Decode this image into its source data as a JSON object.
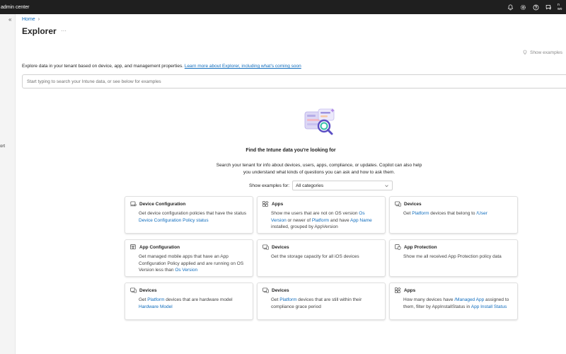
{
  "topbar": {
    "app_title": "admin center",
    "icons": [
      "bell-icon",
      "gear-icon",
      "help-icon",
      "feedback-icon"
    ],
    "account_line1": "n",
    "account_line2": "wo"
  },
  "leftnav": {
    "collapse_glyph": "«",
    "fragment_text": "ort"
  },
  "breadcrumb": {
    "home": "Home"
  },
  "page": {
    "title": "Explorer",
    "more": "···",
    "show_examples": "Show examples",
    "description": "Explore data in your tenant based on device, app, and management properties.",
    "description_link": "Learn more about Explorer, including what's coming soon"
  },
  "search": {
    "placeholder": "Start typing to search your Intune data, or see below for examples",
    "value": ""
  },
  "empty_state": {
    "title": "Find the Intune data you're looking for",
    "description": "Search your tenant for info about devices, users, apps, compliance, or updates. Copilot can also help you understand what kinds of questions you can ask and how to ask them."
  },
  "filter": {
    "label": "Show examples for:",
    "selected": "All categories"
  },
  "colors": {
    "accent": "#0f6cbd",
    "topbar": "#1f1f1f"
  },
  "cards": [
    {
      "icon": "laptop-gear-icon",
      "title": "Device Configuration",
      "body": [
        {
          "t": "Get device configuration policies that have the status "
        },
        {
          "t": "Device Configuration Policy status",
          "hl": true
        }
      ]
    },
    {
      "icon": "apps-grid-icon",
      "title": "Apps",
      "body": [
        {
          "t": "Show me users that are not on OS version "
        },
        {
          "t": "Os Version",
          "hl": true
        },
        {
          "t": " or newer of "
        },
        {
          "t": "Platform",
          "hl": true
        },
        {
          "t": " and have "
        },
        {
          "t": "App Name",
          "hl": true
        },
        {
          "t": " installed, grouped by AppVersion"
        }
      ]
    },
    {
      "icon": "devices-icon",
      "title": "Devices",
      "body": [
        {
          "t": "Get "
        },
        {
          "t": "Platform",
          "hl": true
        },
        {
          "t": " devices that belong to "
        },
        {
          "t": "/User",
          "hl": true
        }
      ]
    },
    {
      "icon": "app-config-icon",
      "title": "App Configuration",
      "body": [
        {
          "t": "Get managed mobile apps that have an App Configuration Policy applied and are running on OS Version less than "
        },
        {
          "t": "Os Version",
          "hl": true
        }
      ]
    },
    {
      "icon": "devices-icon",
      "title": "Devices",
      "body": [
        {
          "t": "Get the storage capacity for all iOS devices"
        }
      ]
    },
    {
      "icon": "app-protection-icon",
      "title": "App Protection",
      "body": [
        {
          "t": "Show me all received App Protection policy data"
        }
      ]
    },
    {
      "icon": "devices-icon",
      "title": "Devices",
      "body": [
        {
          "t": "Get "
        },
        {
          "t": "Platform",
          "hl": true
        },
        {
          "t": " devices that are hardware model "
        },
        {
          "t": "Hardware Model",
          "hl": true
        }
      ]
    },
    {
      "icon": "devices-icon",
      "title": "Devices",
      "body": [
        {
          "t": "Get "
        },
        {
          "t": "Platform",
          "hl": true
        },
        {
          "t": " devices that are still within their compliance grace period"
        }
      ]
    },
    {
      "icon": "apps-grid-icon",
      "title": "Apps",
      "body": [
        {
          "t": "How many devices have "
        },
        {
          "t": "/Managed App",
          "hl": true
        },
        {
          "t": " assigned to them, filter by AppInstallStatus in "
        },
        {
          "t": "App Install Status",
          "hl": true
        }
      ]
    }
  ]
}
